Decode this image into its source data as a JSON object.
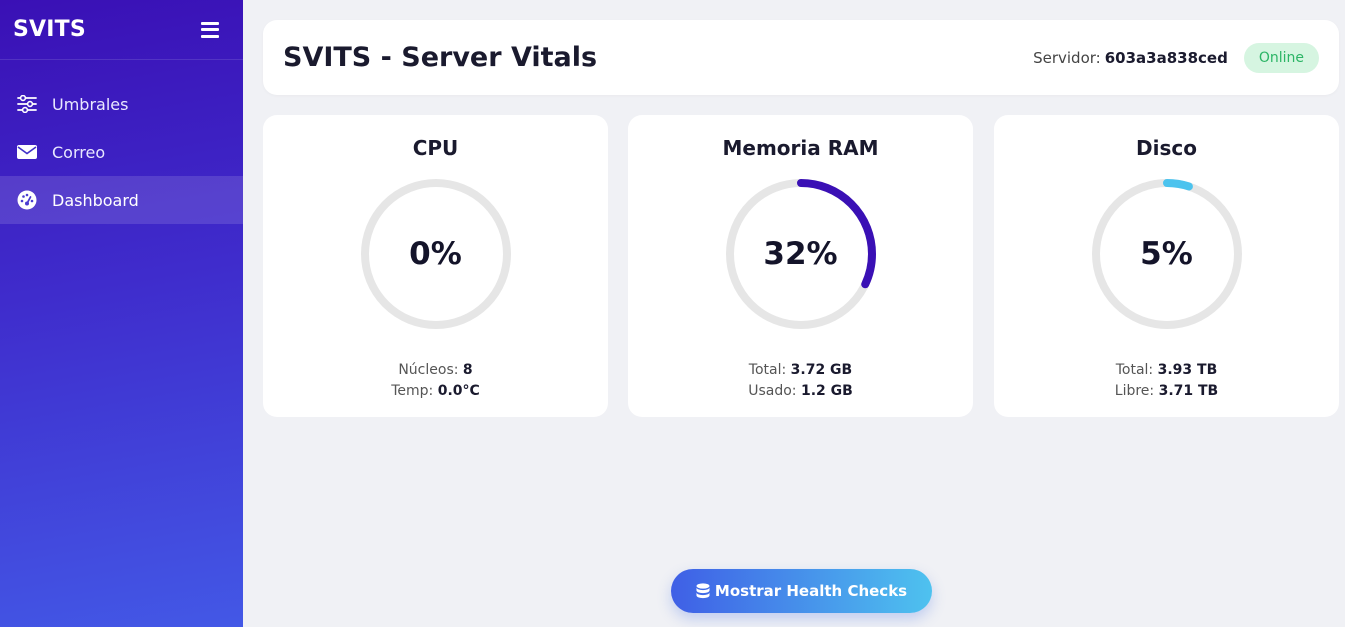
{
  "sidebar": {
    "brand": "SVITS",
    "menu_icon": "hamburger-icon",
    "items": [
      {
        "label": "Umbrales",
        "icon": "sliders-icon"
      },
      {
        "label": "Correo",
        "icon": "envelope-icon"
      },
      {
        "label": "Dashboard",
        "icon": "dashboard-gauge-icon",
        "active": true
      }
    ]
  },
  "header": {
    "title": "SVITS - Server Vitals",
    "server_label": "Servidor:",
    "server_id": "603a3a838ced",
    "status": "Online"
  },
  "cards": [
    {
      "title": "CPU",
      "percent": 0,
      "value_text": "0%",
      "color": "#3a10b5",
      "stats": [
        {
          "label": "Núcleos:",
          "value": "8"
        },
        {
          "label": "Temp:",
          "value": "0.0°C"
        }
      ]
    },
    {
      "title": "Memoria RAM",
      "percent": 32,
      "value_text": "32%",
      "color": "#3a10b5",
      "stats": [
        {
          "label": "Total:",
          "value": "3.72 GB"
        },
        {
          "label": "Usado:",
          "value": "1.2 GB"
        }
      ]
    },
    {
      "title": "Disco",
      "percent": 5,
      "value_text": "5%",
      "color": "#4cc3ee",
      "stats": [
        {
          "label": "Total:",
          "value": "3.93 TB"
        },
        {
          "label": "Libre:",
          "value": "3.71 TB"
        }
      ]
    }
  ],
  "colors": {
    "gauge_track": "#e6e6e6",
    "status_online": "#2cb566"
  },
  "footer": {
    "health_button_label": "Mostrar Health Checks",
    "health_button_icon": "database-icon"
  }
}
